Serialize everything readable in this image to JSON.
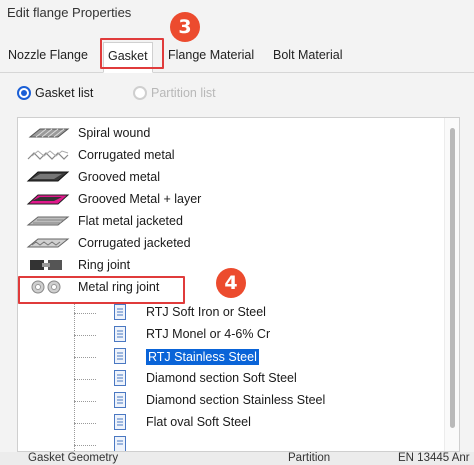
{
  "window": {
    "title": "Edit flange Properties"
  },
  "tabs": [
    {
      "label": "Nozzle Flange"
    },
    {
      "label": "Gasket"
    },
    {
      "label": "Flange Material"
    },
    {
      "label": "Bolt Material"
    }
  ],
  "annotations": {
    "step3": "3",
    "step4": "4",
    "color": "#ec4b2e"
  },
  "radios": {
    "gasket_list": "Gasket list",
    "partition_list": "Partition list",
    "selected": "gasket_list"
  },
  "gasket_types": [
    {
      "label": "Spiral wound",
      "icon": "spiral-wound-icon"
    },
    {
      "label": "Corrugated metal",
      "icon": "corrugated-metal-icon"
    },
    {
      "label": "Grooved metal",
      "icon": "grooved-metal-icon"
    },
    {
      "label": "Grooved Metal + layer",
      "icon": "grooved-metal-layer-icon"
    },
    {
      "label": "Flat metal jacketed",
      "icon": "flat-metal-jacketed-icon"
    },
    {
      "label": "Corrugated jacketed",
      "icon": "corrugated-jacketed-icon"
    },
    {
      "label": "Ring joint",
      "icon": "ring-joint-icon"
    },
    {
      "label": "Metal ring joint",
      "icon": "metal-ring-joint-icon"
    }
  ],
  "metal_ring_joint_children": [
    {
      "label": "RTJ Soft Iron or Steel"
    },
    {
      "label": "RTJ Monel or 4-6% Cr"
    },
    {
      "label": "RTJ Stainless Steel",
      "selected": true
    },
    {
      "label": "Diamond section Soft Steel"
    },
    {
      "label": "Diamond section Stainless Steel"
    },
    {
      "label": "Flat oval Soft Steel"
    }
  ],
  "bottom_bar": {
    "gasket_geometry": "Gasket Geometry",
    "partition": "Partition",
    "standard": "EN 13445 Anr"
  },
  "colors": {
    "selection": "#0a64d8",
    "highlight_box": "#e03b3b"
  }
}
